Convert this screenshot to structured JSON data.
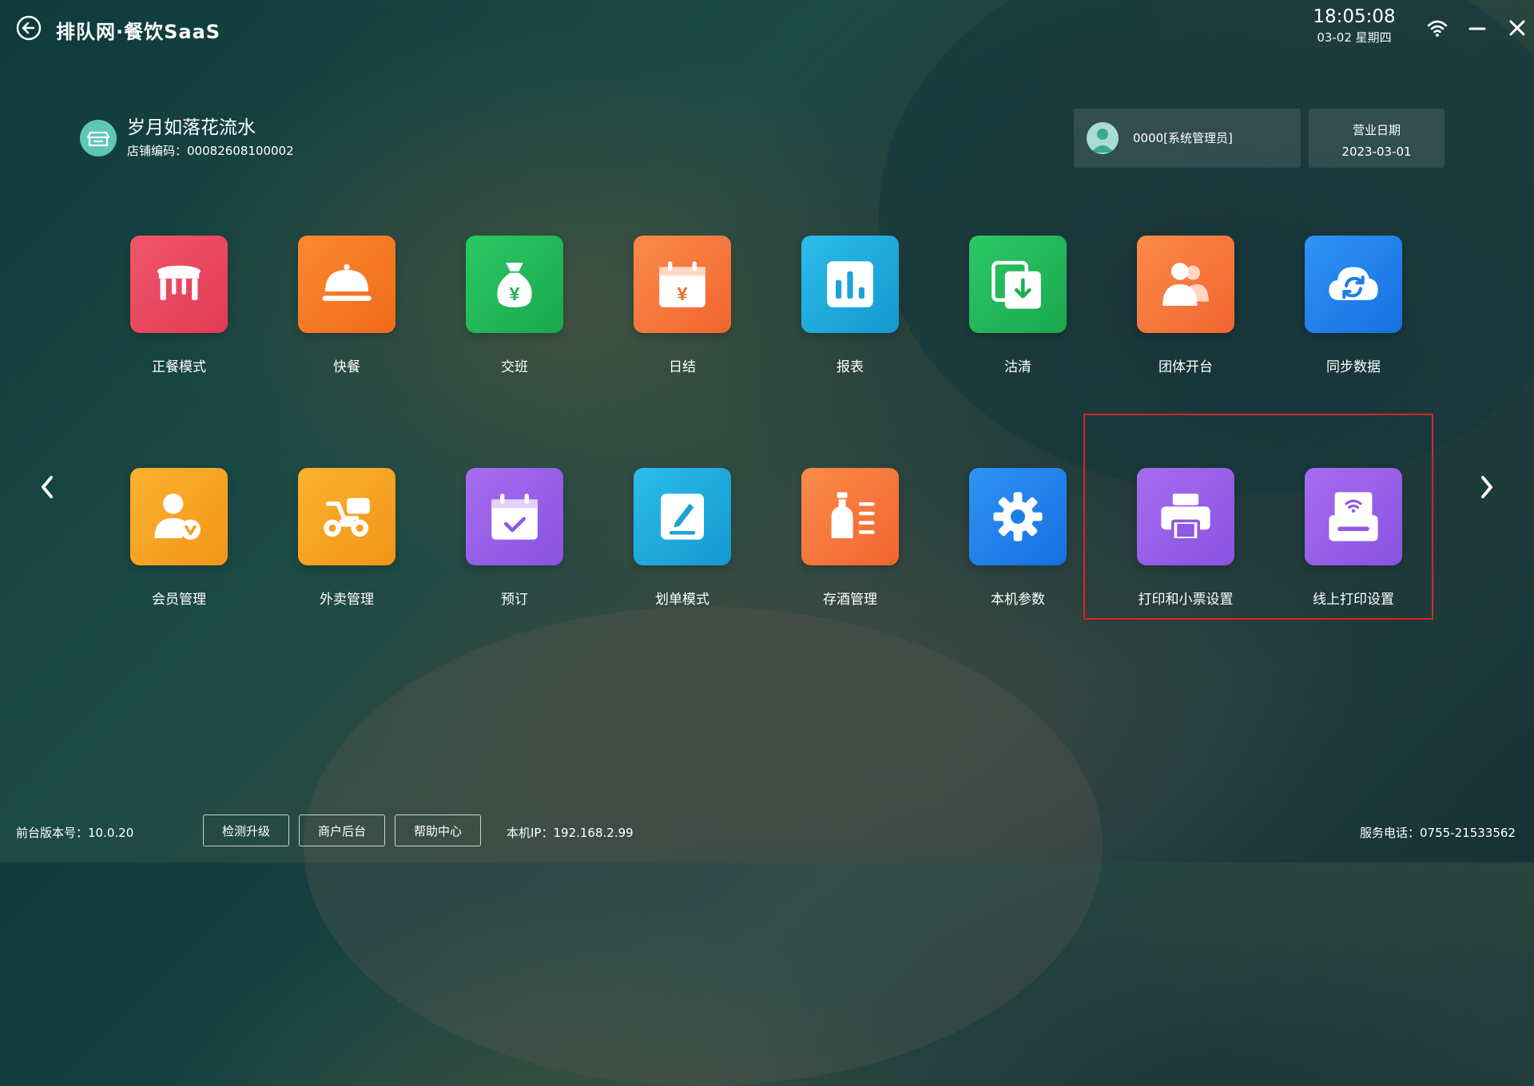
{
  "brand": "排队网·餐饮SaaS",
  "clock": {
    "time": "18:05:08",
    "date": "03-02 星期四"
  },
  "store": {
    "name": "岁月如落花流水",
    "code_label": "店铺编码：",
    "code": "00082608100002"
  },
  "user": {
    "name": "0000[系统管理员]"
  },
  "business_date": {
    "label": "营业日期",
    "value": "2023-03-01"
  },
  "tiles_row1": [
    {
      "label": "正餐模式",
      "color": "#e8485e",
      "icon": "table-icon"
    },
    {
      "label": "快餐",
      "color": "#f57a26",
      "icon": "food-cloche-icon"
    },
    {
      "label": "交班",
      "color": "#22b85a",
      "icon": "money-bag-icon"
    },
    {
      "label": "日结",
      "color": "#f57a3a",
      "icon": "calendar-yen-icon"
    },
    {
      "label": "报表",
      "color": "#1eaee0",
      "icon": "bar-chart-icon"
    },
    {
      "label": "沽清",
      "color": "#22b85a",
      "icon": "clear-stock-icon"
    },
    {
      "label": "团体开台",
      "color": "#f57a3a",
      "icon": "group-users-icon"
    },
    {
      "label": "同步数据",
      "color": "#1e86f0",
      "icon": "cloud-sync-icon"
    }
  ],
  "tiles_row2": [
    {
      "label": "会员管理",
      "color": "#f5a51e",
      "icon": "member-icon"
    },
    {
      "label": "外卖管理",
      "color": "#f5a51e",
      "icon": "delivery-scooter-icon"
    },
    {
      "label": "预订",
      "color": "#9a60e8",
      "icon": "calendar-check-icon"
    },
    {
      "label": "划单模式",
      "color": "#1eaee0",
      "icon": "edit-doc-icon"
    },
    {
      "label": "存酒管理",
      "color": "#f57a3a",
      "icon": "wine-bottle-icon"
    },
    {
      "label": "本机参数",
      "color": "#1e86f0",
      "icon": "gear-icon"
    },
    {
      "label": "打印和小票设置",
      "color": "#9a60e8",
      "icon": "printer-icon"
    },
    {
      "label": "线上打印设置",
      "color": "#9a60e8",
      "icon": "wifi-printer-icon"
    }
  ],
  "footer": {
    "version_label": "前台版本号：",
    "version": "10.0.20",
    "buttons": [
      "检测升级",
      "商户后台",
      "帮助中心"
    ],
    "ip_label": "本机IP：",
    "ip": "192.168.2.99",
    "phone_label": "服务电话：",
    "phone": "0755-21533562"
  }
}
